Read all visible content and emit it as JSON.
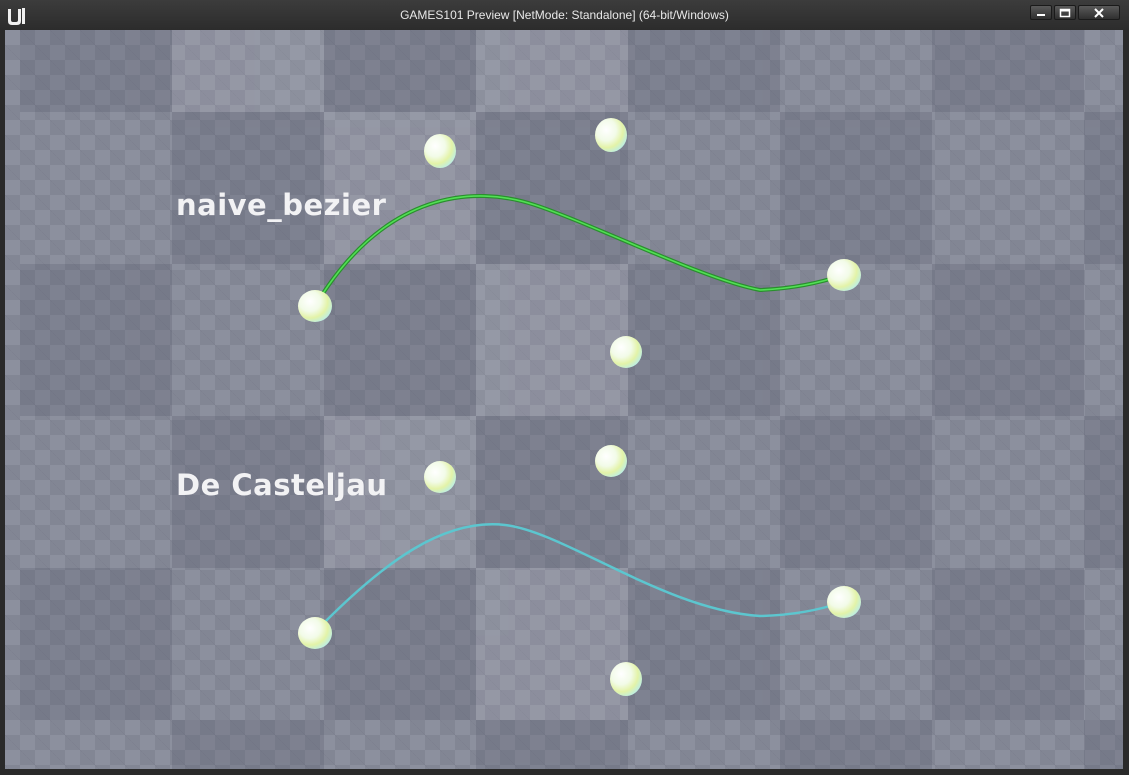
{
  "window": {
    "title": "GAMES101 Preview [NetMode: Standalone]  (64-bit/Windows)",
    "controls": [
      "minimize",
      "maximize",
      "close"
    ]
  },
  "scene": {
    "labels": {
      "top": "naive_bezier",
      "bottom": "De Casteljau"
    },
    "colors": {
      "naive_curve": "#39d13c",
      "casteljau_curve": "#5cc6cf",
      "checker_light": "#9a9dab",
      "checker_dark": "#74788a"
    }
  }
}
